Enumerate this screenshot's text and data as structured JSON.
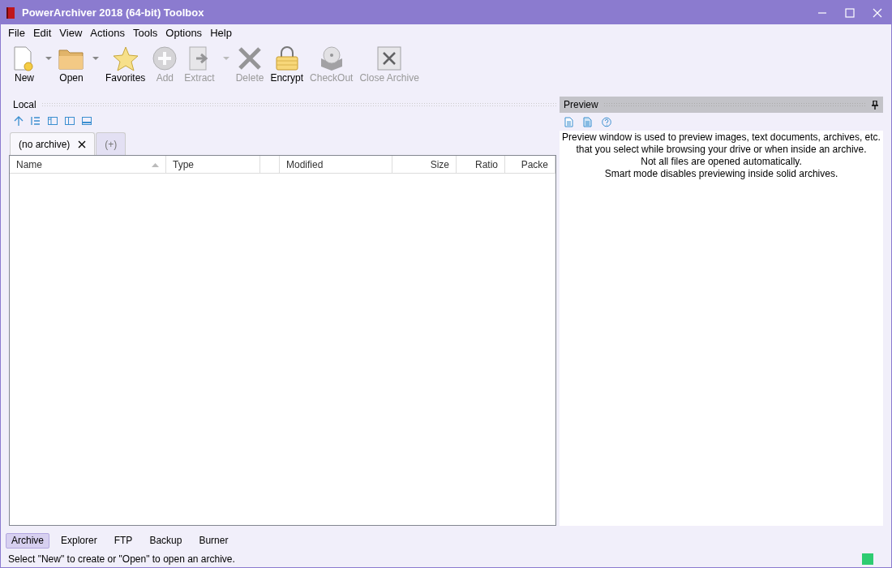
{
  "window": {
    "title": "PowerArchiver 2018 (64-bit) Toolbox"
  },
  "menu": [
    "File",
    "Edit",
    "View",
    "Actions",
    "Tools",
    "Options",
    "Help"
  ],
  "toolbar": [
    {
      "label": "New",
      "disabled": false,
      "dropdown": true
    },
    {
      "label": "Open",
      "disabled": false,
      "dropdown": true
    },
    {
      "label": "Favorites",
      "disabled": false,
      "dropdown": false
    },
    {
      "label": "Add",
      "disabled": true,
      "dropdown": false
    },
    {
      "label": "Extract",
      "disabled": true,
      "dropdown": true
    },
    {
      "label": "Delete",
      "disabled": true,
      "dropdown": false
    },
    {
      "label": "Encrypt",
      "disabled": false,
      "dropdown": false
    },
    {
      "label": "CheckOut",
      "disabled": true,
      "dropdown": false
    },
    {
      "label": "Close Archive",
      "disabled": true,
      "dropdown": false
    }
  ],
  "local_panel": {
    "title": "Local",
    "tabs": [
      {
        "label": "(no archive)",
        "selected": true,
        "closable": true
      },
      {
        "label": "(+)",
        "selected": false,
        "closable": false
      }
    ],
    "table": {
      "columns": [
        {
          "label": "Name",
          "sorted": true
        },
        {
          "label": "Type",
          "sorted": false
        },
        {
          "sorted": false
        },
        {
          "label": "Modified",
          "sorted": false
        },
        {
          "label": "Size",
          "sorted": false
        },
        {
          "label": "Ratio",
          "sorted": false
        },
        {
          "label": "Packe",
          "sorted": false
        }
      ]
    }
  },
  "preview_panel": {
    "title": "Preview",
    "lines": [
      "Preview window is used to preview images, text documents, archives, etc.",
      "that you select while browsing your drive or when inside an archive.",
      "Not all files are opened automatically.",
      "Smart mode disables previewing inside solid archives."
    ]
  },
  "bottom_tabs": [
    {
      "label": "Archive",
      "selected": true
    },
    {
      "label": "Explorer",
      "selected": false
    },
    {
      "label": "FTP",
      "selected": false
    },
    {
      "label": "Backup",
      "selected": false
    },
    {
      "label": "Burner",
      "selected": false
    }
  ],
  "status_bar": {
    "text": "Select \"New\" to create or \"Open\" to open an archive.",
    "color": "#2ecc71"
  }
}
